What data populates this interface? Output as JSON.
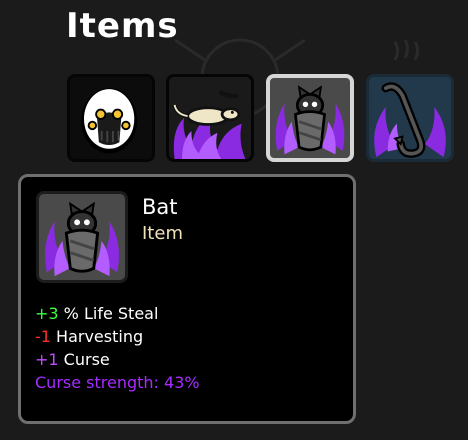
{
  "header": {
    "title": "Items"
  },
  "items": [
    {
      "id": "egg",
      "icon": "spooky-egg-icon",
      "selected": false
    },
    {
      "id": "lizard",
      "icon": "lizard-icon",
      "selected": false,
      "cursed": true
    },
    {
      "id": "bat",
      "icon": "bat-icon",
      "selected": true,
      "cursed": true
    },
    {
      "id": "hook",
      "icon": "hook-icon",
      "selected": false,
      "cursed": true
    }
  ],
  "tooltip": {
    "name": "Bat",
    "type": "Item",
    "icon": "bat-icon",
    "stats": [
      {
        "value": "+3",
        "label": " % Life Steal",
        "kind": "positive"
      },
      {
        "value": "-1",
        "label": " Harvesting",
        "kind": "negative"
      },
      {
        "value": "+1",
        "label": " Curse",
        "kind": "curse"
      }
    ],
    "curse_strength": {
      "label": "Curse strength:",
      "value": "43%"
    }
  },
  "colors": {
    "positive": "#3cff3c",
    "negative": "#ff2d2d",
    "curse": "#c24bff",
    "item_type": "#efe2b6",
    "selected_border": "#d6d6d6"
  }
}
